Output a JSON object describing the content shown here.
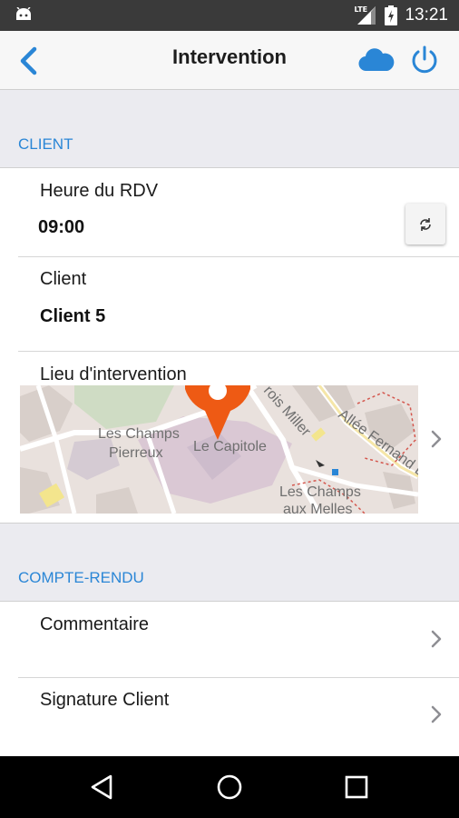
{
  "status_bar": {
    "time": "13:21",
    "network_label": "LTE",
    "icons": [
      "android-icon",
      "lte-signal-icon",
      "battery-icon"
    ]
  },
  "header": {
    "title": "Intervention",
    "back_icon": "back-chevron-icon",
    "cloud_icon": "cloud-icon",
    "power_icon": "power-icon",
    "accent_color": "#2a86d6"
  },
  "client_section": {
    "title": "CLIENT",
    "appointment": {
      "label": "Heure du RDV",
      "value": "09:00"
    },
    "client": {
      "label": "Client",
      "value": "Client 5"
    },
    "location": {
      "label": "Lieu d'intervention",
      "map_labels": [
        "Les Champs",
        "Pierreux",
        "Le Capitole",
        "Les Champs",
        "aux Melles",
        "Allée Fernand Lég",
        "rois Miller"
      ]
    }
  },
  "report_section": {
    "title": "COMPTE-RENDU",
    "items": [
      {
        "label": "Commentaire"
      },
      {
        "label": "Signature Client"
      }
    ]
  },
  "bottom_nav": [
    "back-triangle-icon",
    "home-circle-icon",
    "recents-square-icon"
  ]
}
